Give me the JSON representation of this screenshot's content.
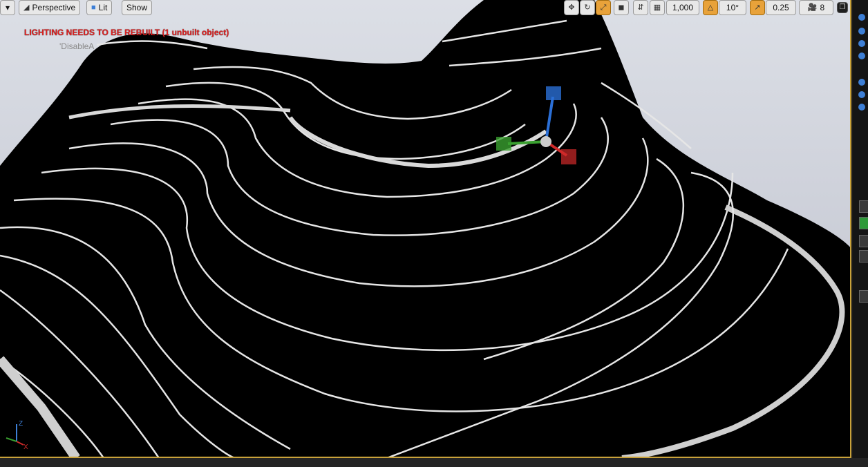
{
  "toolbar": {
    "dropdown_glyph": "▾",
    "perspective_label": "Perspective",
    "lit_label": "Lit",
    "show_label": "Show",
    "grid_snap_value": "1,000",
    "rotation_snap_value": "10°",
    "scale_snap_value": "0.25",
    "camera_speed_value": "8"
  },
  "viewport": {
    "lighting_warning": "LIGHTING NEEDS TO BE REBUILT (1 unbuilt object)",
    "secondary_message": "'DisableA"
  },
  "axis_gizmo": {
    "z_label": "Z",
    "x_label": "X"
  },
  "icons": {
    "translate": "translate-icon",
    "rotate": "rotate-icon",
    "scale": "scale-icon",
    "world": "world-icon",
    "surface_snap": "surface-snap-icon",
    "grid": "grid-icon",
    "angle": "angle-snap-icon",
    "scale_snap": "scale-snap-icon",
    "camera": "camera-speed-icon",
    "maximize": "maximize-icon"
  },
  "colors": {
    "warning_text": "#e02020",
    "active_tool": "#e8a23a",
    "terrain": "#000000",
    "contour": "#e6e6e6"
  }
}
